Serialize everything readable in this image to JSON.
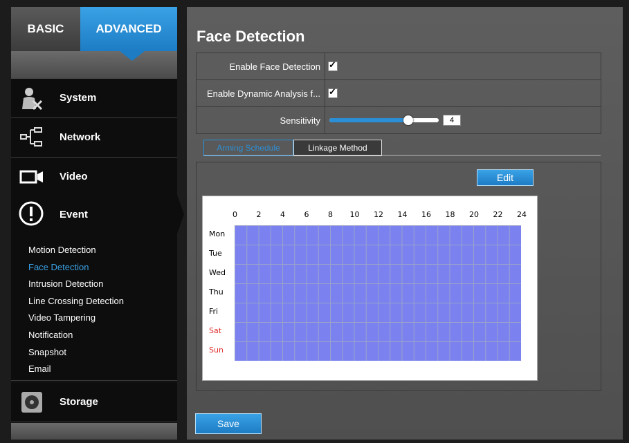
{
  "tabs": {
    "basic": "BASIC",
    "advanced": "ADVANCED"
  },
  "nav": {
    "system": "System",
    "network": "Network",
    "video": "Video",
    "event": "Event",
    "storage": "Storage"
  },
  "event_items": [
    "Motion Detection",
    "Face Detection",
    "Intrusion Detection",
    "Line Crossing Detection",
    "Video Tampering",
    "Notification",
    "Snapshot",
    "Email"
  ],
  "page": {
    "title": "Face Detection"
  },
  "form": {
    "enable_label": "Enable Face Detection",
    "enable_checked": true,
    "dynamic_label": "Enable Dynamic Analysis f...",
    "dynamic_checked": true,
    "sensitivity_label": "Sensitivity",
    "sensitivity_value": "4"
  },
  "subtabs": {
    "arming": "Arming Schedule",
    "linkage": "Linkage Method"
  },
  "edit_label": "Edit",
  "save_label": "Save",
  "schedule": {
    "hours": [
      "0",
      "2",
      "4",
      "6",
      "8",
      "10",
      "12",
      "14",
      "16",
      "18",
      "20",
      "22",
      "24"
    ],
    "days": [
      "Mon",
      "Tue",
      "Wed",
      "Thu",
      "Fri",
      "Sat",
      "Sun"
    ],
    "weekend": [
      "Sat",
      "Sun"
    ]
  },
  "colors": {
    "accent": "#2b8fd8",
    "schedule_fill": "#7b82f0",
    "weekend": "#e03030"
  }
}
